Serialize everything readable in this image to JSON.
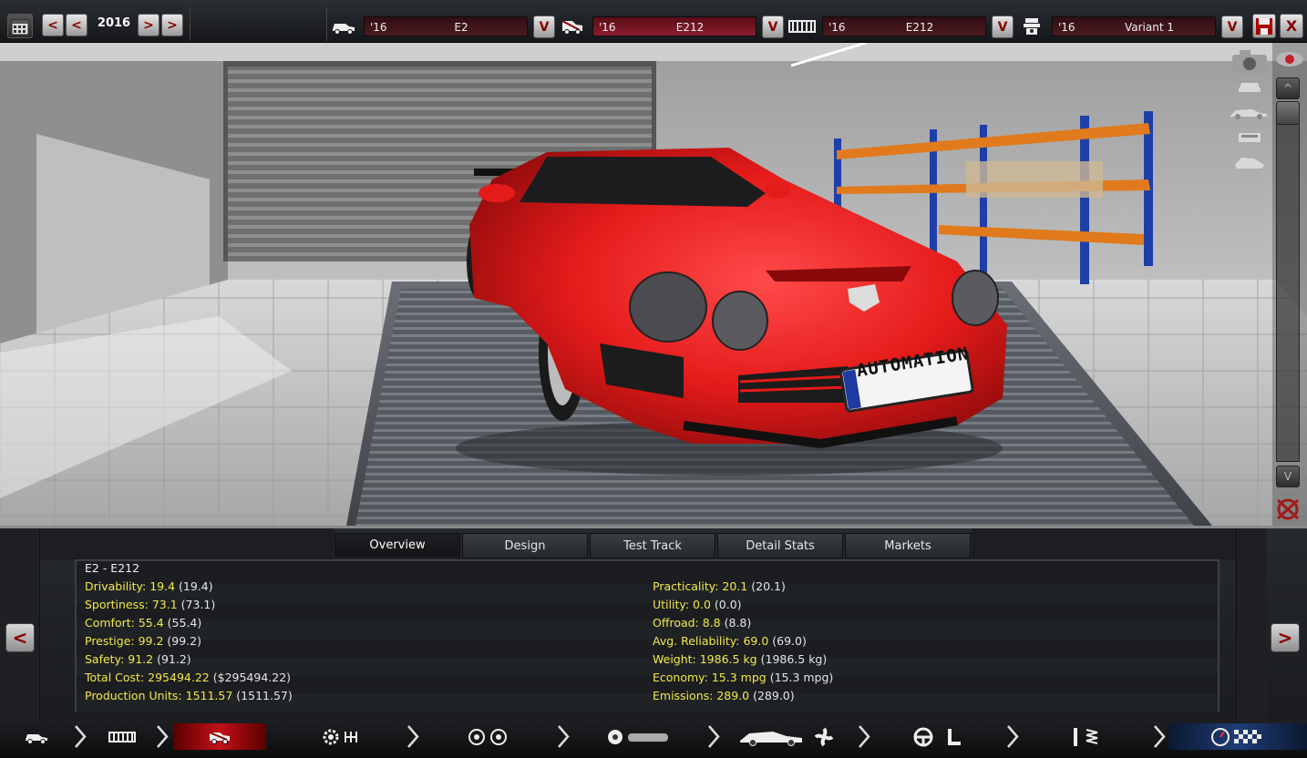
{
  "topbar": {
    "year": "2016",
    "year_prev_labels": [
      "<",
      "<"
    ],
    "year_next_labels": [
      ">",
      ">"
    ],
    "car": {
      "year": "'16",
      "name": "E2"
    },
    "trim": {
      "year": "'16",
      "name": "E212"
    },
    "chassis": {
      "year": "'16",
      "name": "E212"
    },
    "engine": {
      "year": "'16",
      "name": "Variant 1"
    },
    "dropdown_label": "V",
    "close_label": "X"
  },
  "viewport": {
    "plate_text": "AUTOMATION",
    "scroll_up": "^",
    "scroll_down": "V"
  },
  "panel": {
    "tabs": [
      {
        "label": "Overview",
        "active": true
      },
      {
        "label": "Design"
      },
      {
        "label": "Test Track"
      },
      {
        "label": "Detail Stats"
      },
      {
        "label": "Markets"
      }
    ],
    "prev_label": "<",
    "next_label": ">",
    "title": "E2 - E212",
    "left_stats": [
      {
        "label": "Drivability: 19.4",
        "paren": "(19.4)"
      },
      {
        "label": "Sportiness: 73.1",
        "paren": "(73.1)"
      },
      {
        "label": "Comfort: 55.4",
        "paren": "(55.4)"
      },
      {
        "label": "Prestige: 99.2",
        "paren": "(99.2)"
      },
      {
        "label": "Safety: 91.2",
        "paren": "(91.2)"
      },
      {
        "label": "Total Cost: 295494.22",
        "paren": "($295494.22)"
      },
      {
        "label": "Production Units: 1511.57",
        "paren": "(1511.57)"
      }
    ],
    "right_stats": [
      {
        "label": "Practicality: 20.1",
        "paren": "(20.1)"
      },
      {
        "label": "Utility: 0.0",
        "paren": "(0.0)"
      },
      {
        "label": "Offroad: 8.8",
        "paren": "(8.8)"
      },
      {
        "label": "Avg. Reliability: 69.0",
        "paren": "(69.0)"
      },
      {
        "label": "Weight: 1986.5 kg",
        "paren": "(1986.5 kg)"
      },
      {
        "label": "Economy: 15.3 mpg",
        "paren": "(15.3 mpg)"
      },
      {
        "label": "Emissions: 289.0",
        "paren": "(289.0)"
      }
    ]
  },
  "navbar": {
    "steps": [
      "car-icon",
      "chassis-icon",
      "trim-icon",
      "engine-icon",
      "wheels-icon",
      "body-icon",
      "interior-icon",
      "suspension-icon",
      "testing-icon"
    ]
  },
  "colors": {
    "stat_label": "#f2e84a",
    "car_red": "#e51b1b",
    "nav_active": "#c40f18",
    "nav_final": "#1f3d78"
  }
}
